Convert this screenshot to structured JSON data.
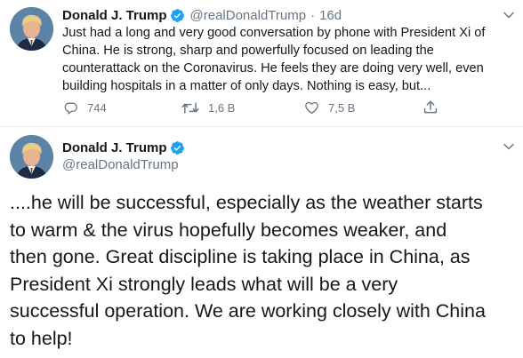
{
  "tweet1": {
    "author_name": "Donald J. Trump",
    "handle": "@realDonaldTrump",
    "time_sep": "·",
    "time": "16d",
    "text_lines": [
      "Just had a long and very good conversation by phone with President Xi of",
      "China. He is strong, sharp and powerfully focused on leading the",
      "counterattack on the Coronavirus. He feels they are doing very well, even",
      "building hospitals in a matter of only days. Nothing is easy, but..."
    ],
    "replies": "744",
    "retweets": "1,6 B",
    "likes": "7,5 B",
    "icons": {
      "avatar": "avatar-photo",
      "verified": "verified-badge-icon",
      "reply": "reply-icon",
      "retweet": "retweet-icon",
      "like": "heart-icon",
      "share": "share-icon",
      "more": "chevron-down-icon"
    }
  },
  "tweet2": {
    "author_name": "Donald J. Trump",
    "handle": "@realDonaldTrump",
    "text_lines": [
      "....he will be successful, especially as the weather starts",
      "to warm & the virus hopefully becomes weaker, and",
      "then gone. Great discipline is taking place in China, as",
      "President Xi strongly leads what will be a very",
      "successful operation. We are working closely with China",
      "to help!"
    ]
  },
  "colors": {
    "verified": "#1da1f2",
    "secondary_text": "#657786",
    "primary_text": "#14171a"
  }
}
